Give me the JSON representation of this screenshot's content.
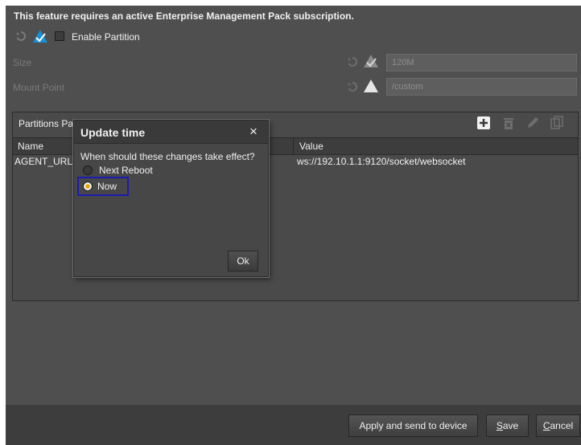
{
  "notice": "This feature requires an active Enterprise Management Pack subscription.",
  "enable_partition": {
    "label": "Enable Partition",
    "checked": false
  },
  "size": {
    "label": "Size",
    "value": "120M"
  },
  "mount_point": {
    "label": "Mount Point",
    "value": "/custom"
  },
  "table": {
    "title": "Partitions Pa",
    "toolbar": [
      "add-icon",
      "delete-icon",
      "edit-icon",
      "copy-icon"
    ],
    "columns": [
      "Name",
      "Value"
    ],
    "rows": [
      {
        "name": "AGENT_URL",
        "value": "ws://192.10.1.1:9120/socket/websocket"
      }
    ]
  },
  "dialog": {
    "title": "Update time",
    "close": "×",
    "question": "When should these changes take effect?",
    "options": [
      "Next Reboot",
      "Now"
    ],
    "selected": "Now",
    "ok": "Ok"
  },
  "footer": {
    "apply": "Apply and send to device",
    "save_first": "S",
    "save_rest": "ave",
    "cancel_first": "C",
    "cancel_rest": "ancel"
  },
  "colors": {
    "accent": "#1a8fd6",
    "focus": "#1d1ab0",
    "radio_dot": "#e0a800"
  }
}
